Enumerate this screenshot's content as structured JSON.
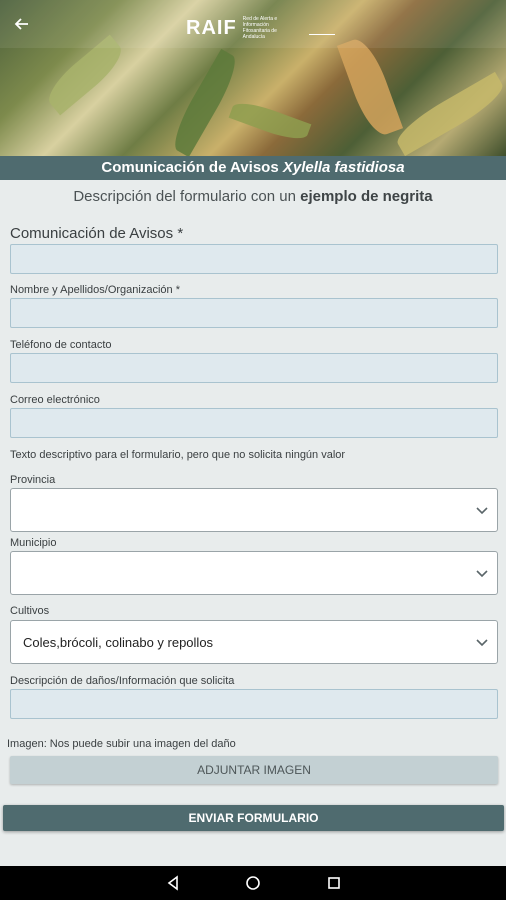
{
  "header": {
    "brand": "RAIF",
    "brand_sub": "Red de Alerta e Información Fitosanitaria de Andalucía",
    "back_icon": "arrow-left-icon"
  },
  "title": {
    "prefix": "Comunicación de Avisos ",
    "species": "Xylella fastidiosa"
  },
  "description": {
    "text": "Descripción del formulario con un ",
    "bold": "ejemplo de negrita"
  },
  "form": {
    "aviso_label": "Comunicación de Avisos *",
    "aviso_value": "",
    "nombre_label": "Nombre y Apellidos/Organización *",
    "nombre_value": "",
    "telefono_label": "Teléfono de contacto",
    "telefono_value": "",
    "correo_label": "Correo electrónico",
    "correo_value": "",
    "info_text": "Texto descriptivo para el formulario, pero que no solicita ningún valor",
    "provincia_label": "Provincia",
    "provincia_value": "",
    "municipio_label": "Municipio",
    "municipio_value": "",
    "cultivos_label": "Cultivos",
    "cultivos_value": "Coles,brócoli, colinabo y  repollos",
    "danos_label": "Descripción de daños/Información que solicita",
    "danos_value": "",
    "imagen_text": "Imagen: Nos puede subir una imagen del daño",
    "attach_label": "ADJUNTAR IMAGEN",
    "send_label": "ENVIAR FORMULARIO"
  },
  "colors": {
    "accent": "#4f6b6f",
    "field_bg": "#dfe9ee",
    "field_border": "#a9c3cf",
    "button_secondary": "#c3d0d3"
  }
}
